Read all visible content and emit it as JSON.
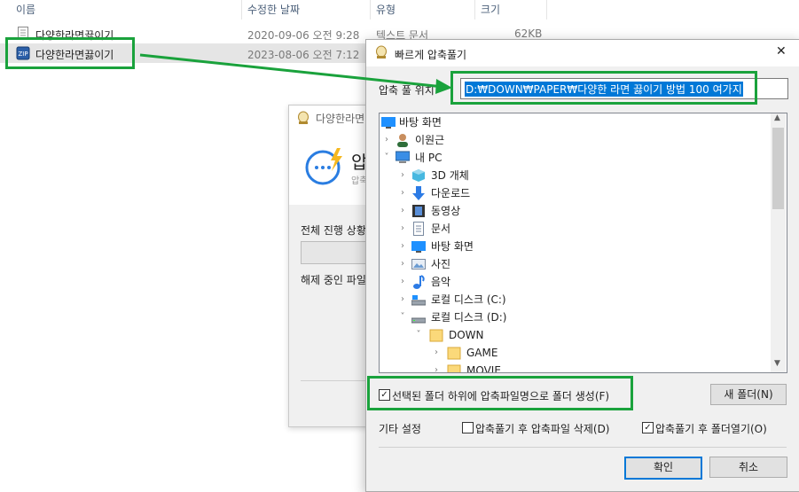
{
  "explorer": {
    "columns": {
      "name": "이름",
      "date": "수정한 날짜",
      "type": "유형",
      "size": "크기"
    },
    "rows": [
      {
        "name": "다양한라면끓이기",
        "date": "2020-09-06 오전 9:28",
        "type": "텍스트 문서",
        "size": "62KB"
      },
      {
        "name": "다양한라면끓이기",
        "date": "2023-08-06 오전 7:12",
        "type": "",
        "size": ""
      }
    ]
  },
  "progress_dialog": {
    "title": "다양한라면",
    "heading": "압",
    "subheading": "압축",
    "overall_label": "전체 진행 상황",
    "extracting_label": "해제 중인 파일"
  },
  "extract_dialog": {
    "title": "빠르게 압축풀기",
    "path_label": "압축 풀 위치",
    "path_value": "D:₩DOWN₩PAPER₩다양한 라면 끓이기 방법 100 여가지",
    "tree": [
      {
        "label": "바탕 화면",
        "icon": "desktop-icon"
      },
      {
        "label": "이원근",
        "icon": "user-icon"
      },
      {
        "label": "내 PC",
        "icon": "pc-icon"
      },
      {
        "label": "3D 개체",
        "icon": "3d-objects-icon"
      },
      {
        "label": "다운로드",
        "icon": "download-icon"
      },
      {
        "label": "동영상",
        "icon": "video-icon"
      },
      {
        "label": "문서",
        "icon": "document-icon"
      },
      {
        "label": "바탕 화면",
        "icon": "desktop-icon"
      },
      {
        "label": "사진",
        "icon": "pictures-icon"
      },
      {
        "label": "음악",
        "icon": "music-icon"
      },
      {
        "label": "로컬 디스크 (C:)",
        "icon": "drive-icon"
      },
      {
        "label": "로컬 디스크 (D:)",
        "icon": "drive-icon"
      },
      {
        "label": "DOWN",
        "icon": "folder-icon"
      },
      {
        "label": "GAME",
        "icon": "folder-icon"
      },
      {
        "label": "MOVIE",
        "icon": "folder-icon"
      }
    ],
    "create_folder_label": "선택된 폴더 하위에 압축파일명으로 폴더 생성(F)",
    "new_folder_label": "새 폴더(N)",
    "other_settings_label": "기타 설정",
    "delete_after_label": "압축풀기 후 압축파일 삭제(D)",
    "open_after_label": "압축풀기 후 폴더열기(O)",
    "ok_label": "확인",
    "cancel_label": "취소",
    "close_glyph": "✕"
  },
  "colors": {
    "highlight": "#1aa23c",
    "selection": "#0078d7",
    "row_selected": "#e5e5e5"
  }
}
